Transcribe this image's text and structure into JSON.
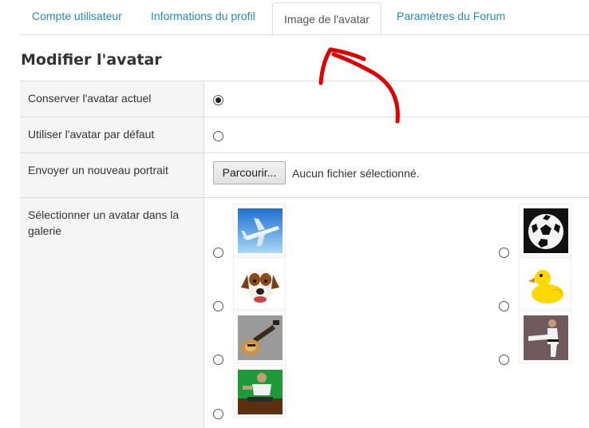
{
  "tabs": [
    {
      "label": "Compte utilisateur"
    },
    {
      "label": "Informations du profil"
    },
    {
      "label": "Image de l'avatar",
      "active": true
    },
    {
      "label": "Paramètres du Forum"
    }
  ],
  "section": {
    "title": "Modifier l'avatar"
  },
  "options": {
    "keep_current": {
      "label": "Conserver l'avatar actuel",
      "selected": true
    },
    "use_default": {
      "label": "Utiliser l'avatar par défaut",
      "selected": false
    },
    "upload": {
      "label": "Envoyer un nouveau portrait",
      "button_label": "Parcourir...",
      "status": "Aucun fichier sélectionné."
    },
    "gallery": {
      "label": "Sélectionner un avatar dans la galerie",
      "items": [
        {
          "icon": "airplane-avatar-icon",
          "selected": false
        },
        {
          "icon": "soccer-ball-avatar-icon",
          "selected": false
        },
        {
          "icon": "dog-avatar-icon",
          "selected": false
        },
        {
          "icon": "rubber-duck-avatar-icon",
          "selected": false
        },
        {
          "icon": "bass-guitar-avatar-icon",
          "selected": false
        },
        {
          "icon": "karate-avatar-icon",
          "selected": false
        },
        {
          "icon": "gymnast-avatar-icon",
          "selected": false
        }
      ]
    }
  },
  "colors": {
    "tab_link": "#2a88b9",
    "annotation_arrow": "#e00000",
    "label_background": "#f5f5f5",
    "border": "#dddddd"
  }
}
